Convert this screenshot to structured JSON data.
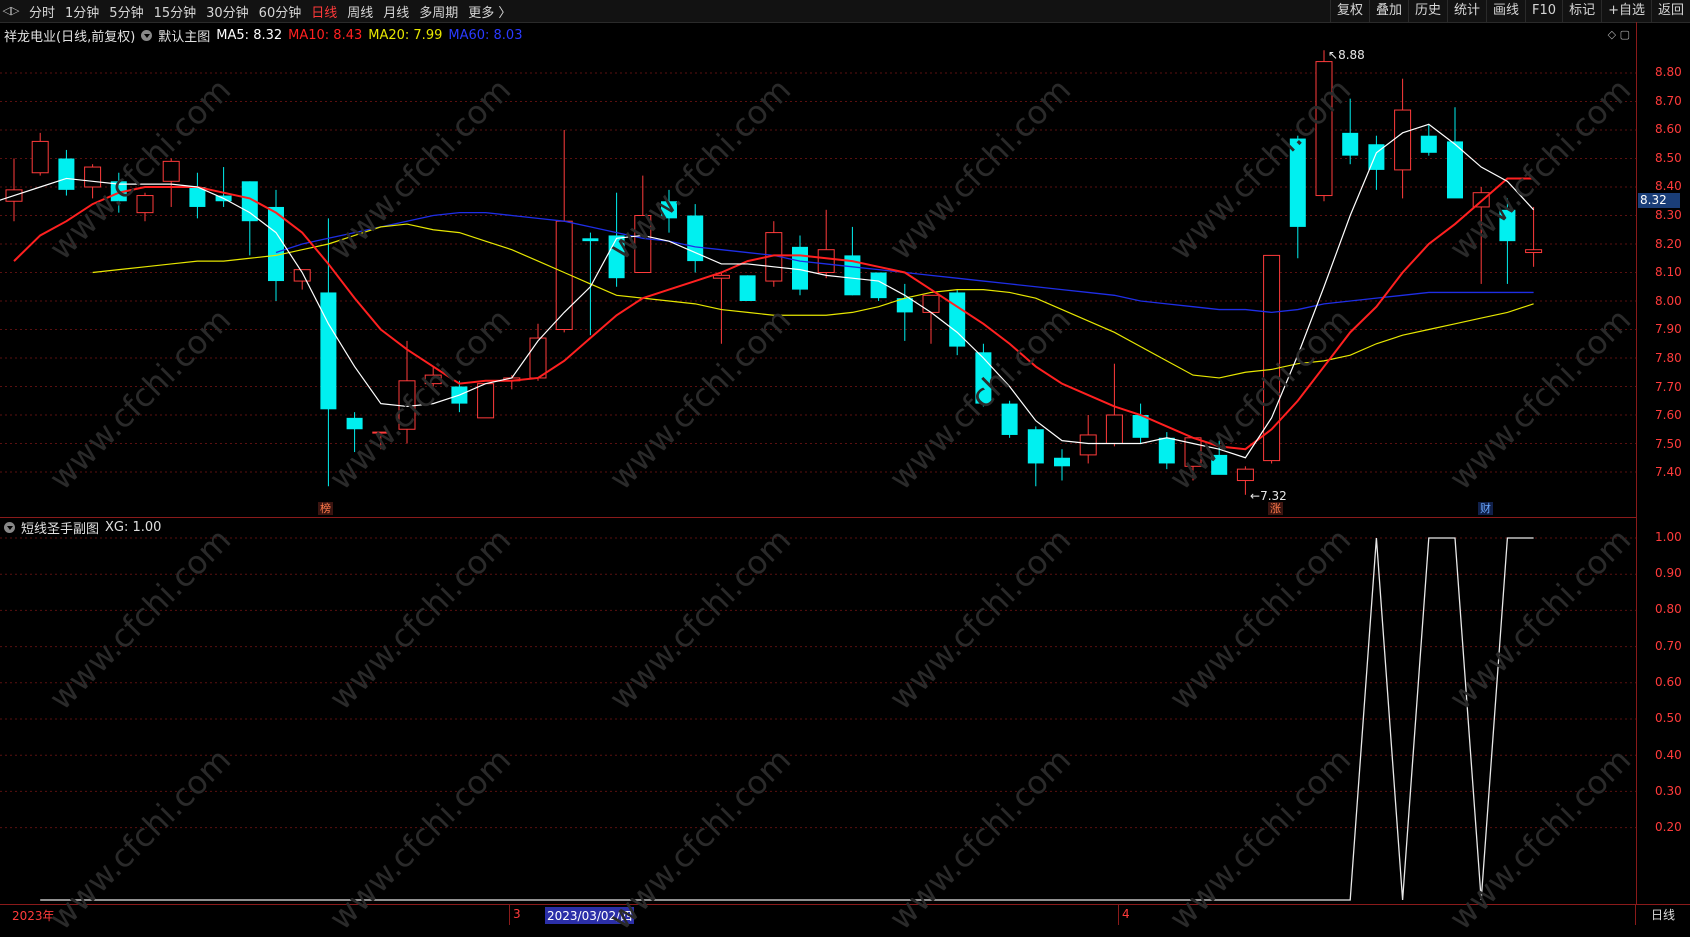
{
  "toolbar": {
    "periods": [
      "分时",
      "1分钟",
      "5分钟",
      "15分钟",
      "30分钟",
      "60分钟",
      "日线",
      "周线",
      "月线",
      "多周期",
      "更多 〉"
    ],
    "active_period": "日线",
    "right_buttons": [
      "复权",
      "叠加",
      "历史",
      "统计",
      "画线",
      "F10",
      "标记",
      "+自选",
      "返回"
    ]
  },
  "main_info": {
    "title": "祥龙电业(日线,前复权)",
    "chart_name": "默认主图",
    "ma5": "MA5: 8.32",
    "ma10": "MA10: 8.43",
    "ma20": "MA20: 7.99",
    "ma60": "MA60: 8.03"
  },
  "sub_info": {
    "title": "短线圣手副图",
    "xg": "XG: 1.00"
  },
  "price_axis": {
    "ticks": [
      "8.80",
      "8.70",
      "8.60",
      "8.50",
      "8.40",
      "8.30",
      "8.20",
      "8.10",
      "8.00",
      "7.90",
      "7.80",
      "7.70",
      "7.60",
      "7.50",
      "7.40"
    ],
    "current": "8.32"
  },
  "sub_axis": {
    "ticks": [
      "1.00",
      "0.90",
      "0.80",
      "0.70",
      "0.60",
      "0.50",
      "0.40",
      "0.30",
      "0.20"
    ]
  },
  "markers": {
    "high": "8.88",
    "low": "7.32",
    "m1": "榜",
    "m2": "涨",
    "m3": "财"
  },
  "dates": {
    "year": "2023年",
    "m3": "3",
    "selected": "2023/03/02/四",
    "m4": "4"
  },
  "period_label": "日线",
  "watermark": "www.cfchi.com",
  "colors": {
    "up": "#ff3b3b",
    "down": "#00f0f0",
    "ma5": "#ffffff",
    "ma10": "#ff2020",
    "ma20": "#e6e600",
    "ma60": "#1e2ee6",
    "grid": "#5a1010"
  },
  "chart_data": [
    {
      "type": "candlestick",
      "title": "祥龙电业(日线,前复权)",
      "ylim": [
        7.3,
        8.9
      ],
      "candles": [
        {
          "o": 8.35,
          "h": 8.5,
          "l": 8.28,
          "c": 8.39
        },
        {
          "o": 8.45,
          "h": 8.59,
          "l": 8.44,
          "c": 8.56
        },
        {
          "o": 8.5,
          "h": 8.53,
          "l": 8.37,
          "c": 8.39
        },
        {
          "o": 8.4,
          "h": 8.48,
          "l": 8.36,
          "c": 8.47
        },
        {
          "o": 8.42,
          "h": 8.45,
          "l": 8.31,
          "c": 8.35
        },
        {
          "o": 8.31,
          "h": 8.38,
          "l": 8.28,
          "c": 8.37
        },
        {
          "o": 8.42,
          "h": 8.5,
          "l": 8.33,
          "c": 8.49
        },
        {
          "o": 8.4,
          "h": 8.45,
          "l": 8.29,
          "c": 8.33
        },
        {
          "o": 8.37,
          "h": 8.47,
          "l": 8.33,
          "c": 8.35
        },
        {
          "o": 8.42,
          "h": 8.42,
          "l": 8.16,
          "c": 8.28
        },
        {
          "o": 8.33,
          "h": 8.39,
          "l": 8.0,
          "c": 8.07
        },
        {
          "o": 8.07,
          "h": 8.1,
          "l": 8.04,
          "c": 8.11
        },
        {
          "o": 8.03,
          "h": 8.29,
          "l": 7.35,
          "c": 7.62
        },
        {
          "o": 7.59,
          "h": 7.61,
          "l": 7.47,
          "c": 7.55
        },
        {
          "o": 7.54,
          "h": 7.54,
          "l": 7.48,
          "c": 7.54
        },
        {
          "o": 7.55,
          "h": 7.86,
          "l": 7.5,
          "c": 7.72
        },
        {
          "o": 7.71,
          "h": 7.77,
          "l": 7.7,
          "c": 7.74
        },
        {
          "o": 7.7,
          "h": 7.72,
          "l": 7.61,
          "c": 7.64
        },
        {
          "o": 7.59,
          "h": 7.71,
          "l": 7.59,
          "c": 7.71
        },
        {
          "o": 7.72,
          "h": 7.74,
          "l": 7.69,
          "c": 7.73
        },
        {
          "o": 7.73,
          "h": 7.92,
          "l": 7.72,
          "c": 7.87
        },
        {
          "o": 7.9,
          "h": 8.6,
          "l": 7.89,
          "c": 8.28
        },
        {
          "o": 8.22,
          "h": 8.24,
          "l": 7.88,
          "c": 8.21
        },
        {
          "o": 8.23,
          "h": 8.38,
          "l": 8.05,
          "c": 8.08
        },
        {
          "o": 8.1,
          "h": 8.44,
          "l": 8.1,
          "c": 8.3
        },
        {
          "o": 8.35,
          "h": 8.39,
          "l": 8.24,
          "c": 8.29
        },
        {
          "o": 8.3,
          "h": 8.34,
          "l": 8.1,
          "c": 8.14
        },
        {
          "o": 8.08,
          "h": 8.1,
          "l": 7.85,
          "c": 8.09
        },
        {
          "o": 8.09,
          "h": 8.09,
          "l": 8.0,
          "c": 8.0
        },
        {
          "o": 8.07,
          "h": 8.28,
          "l": 8.05,
          "c": 8.24
        },
        {
          "o": 8.19,
          "h": 8.23,
          "l": 8.02,
          "c": 8.04
        },
        {
          "o": 8.1,
          "h": 8.32,
          "l": 8.08,
          "c": 8.18
        },
        {
          "o": 8.16,
          "h": 8.26,
          "l": 8.02,
          "c": 8.02
        },
        {
          "o": 8.1,
          "h": 8.1,
          "l": 8.0,
          "c": 8.01
        },
        {
          "o": 8.01,
          "h": 8.06,
          "l": 7.86,
          "c": 7.96
        },
        {
          "o": 7.96,
          "h": 8.02,
          "l": 7.85,
          "c": 8.02
        },
        {
          "o": 8.03,
          "h": 8.04,
          "l": 7.81,
          "c": 7.84
        },
        {
          "o": 7.82,
          "h": 7.85,
          "l": 7.63,
          "c": 7.64
        },
        {
          "o": 7.64,
          "h": 7.65,
          "l": 7.52,
          "c": 7.53
        },
        {
          "o": 7.55,
          "h": 7.56,
          "l": 7.35,
          "c": 7.43
        },
        {
          "o": 7.45,
          "h": 7.48,
          "l": 7.37,
          "c": 7.42
        },
        {
          "o": 7.46,
          "h": 7.6,
          "l": 7.43,
          "c": 7.53
        },
        {
          "o": 7.5,
          "h": 7.78,
          "l": 7.49,
          "c": 7.6
        },
        {
          "o": 7.6,
          "h": 7.64,
          "l": 7.5,
          "c": 7.52
        },
        {
          "o": 7.52,
          "h": 7.54,
          "l": 7.41,
          "c": 7.43
        },
        {
          "o": 7.42,
          "h": 7.52,
          "l": 7.37,
          "c": 7.52
        },
        {
          "o": 7.46,
          "h": 7.51,
          "l": 7.4,
          "c": 7.39
        },
        {
          "o": 7.37,
          "h": 7.42,
          "l": 7.32,
          "c": 7.41
        },
        {
          "o": 7.44,
          "h": 8.16,
          "l": 7.43,
          "c": 8.16
        },
        {
          "o": 8.57,
          "h": 8.58,
          "l": 8.15,
          "c": 8.26
        },
        {
          "o": 8.37,
          "h": 8.88,
          "l": 8.35,
          "c": 8.84
        },
        {
          "o": 8.59,
          "h": 8.71,
          "l": 8.48,
          "c": 8.51
        },
        {
          "o": 8.55,
          "h": 8.58,
          "l": 8.39,
          "c": 8.46
        },
        {
          "o": 8.46,
          "h": 8.78,
          "l": 8.36,
          "c": 8.67
        },
        {
          "o": 8.58,
          "h": 8.62,
          "l": 8.51,
          "c": 8.52
        },
        {
          "o": 8.56,
          "h": 8.68,
          "l": 8.37,
          "c": 8.36
        },
        {
          "o": 8.33,
          "h": 8.4,
          "l": 8.06,
          "c": 8.38
        },
        {
          "o": 8.32,
          "h": 8.36,
          "l": 8.06,
          "c": 8.21
        },
        {
          "o": 8.17,
          "h": 8.33,
          "l": 8.12,
          "c": 8.18
        }
      ],
      "ma5": [
        8.34,
        8.37,
        8.4,
        8.43,
        8.42,
        8.41,
        8.41,
        8.41,
        8.4,
        8.36,
        8.31,
        8.24,
        8.1,
        7.92,
        7.77,
        7.64,
        7.63,
        7.64,
        7.67,
        7.71,
        7.73,
        7.86,
        7.96,
        8.05,
        8.22,
        8.23,
        8.21,
        8.17,
        8.13,
        8.13,
        8.12,
        8.11,
        8.09,
        8.08,
        8.07,
        8.02,
        7.96,
        7.89,
        7.8,
        7.7,
        7.58,
        7.51,
        7.5,
        7.5,
        7.5,
        7.52,
        7.5,
        7.48,
        7.45,
        7.59,
        7.81,
        8.05,
        8.3,
        8.52,
        8.59,
        8.62,
        8.55,
        8.47,
        8.42,
        8.32
      ],
      "ma10": [
        8.14,
        8.23,
        8.28,
        8.34,
        8.38,
        8.4,
        8.4,
        8.4,
        8.38,
        8.36,
        8.31,
        8.24,
        8.13,
        8.01,
        7.9,
        7.83,
        7.77,
        7.71,
        7.72,
        7.72,
        7.73,
        7.79,
        7.87,
        7.95,
        8.01,
        8.04,
        8.07,
        8.1,
        8.14,
        8.16,
        8.16,
        8.15,
        8.14,
        8.12,
        8.1,
        8.04,
        7.98,
        7.92,
        7.85,
        7.77,
        7.71,
        7.67,
        7.63,
        7.6,
        7.56,
        7.52,
        7.49,
        7.48,
        7.55,
        7.65,
        7.77,
        7.89,
        7.98,
        8.1,
        8.2,
        8.27,
        8.35,
        8.43,
        8.43
      ],
      "ma20": [
        8.1,
        8.11,
        8.12,
        8.13,
        8.14,
        8.14,
        8.15,
        8.16,
        8.18,
        8.2,
        8.23,
        8.26,
        8.27,
        8.25,
        8.24,
        8.21,
        8.18,
        8.14,
        8.1,
        8.06,
        8.02,
        8.01,
        8.0,
        7.99,
        7.97,
        7.96,
        7.95,
        7.95,
        7.95,
        7.96,
        7.98,
        8.01,
        8.03,
        8.04,
        8.04,
        8.03,
        8.01,
        7.97,
        7.93,
        7.89,
        7.84,
        7.79,
        7.74,
        7.73,
        7.75,
        7.76,
        7.78,
        7.79,
        7.81,
        7.85,
        7.88,
        7.9,
        7.92,
        7.94,
        7.96,
        7.99
      ],
      "ma60": [
        8.17,
        8.2,
        8.22,
        8.24,
        8.26,
        8.28,
        8.3,
        8.31,
        8.31,
        8.3,
        8.29,
        8.28,
        8.26,
        8.24,
        8.22,
        8.21,
        8.19,
        8.18,
        8.17,
        8.16,
        8.14,
        8.13,
        8.12,
        8.11,
        8.1,
        8.09,
        8.08,
        8.07,
        8.06,
        8.05,
        8.04,
        8.03,
        8.02,
        8.0,
        7.99,
        7.98,
        7.97,
        7.97,
        7.96,
        7.97,
        7.99,
        8.0,
        8.01,
        8.02,
        8.03,
        8.03,
        8.03,
        8.03,
        8.03
      ]
    },
    {
      "type": "line",
      "title": "短线圣手副图",
      "ylim": [
        0,
        1
      ],
      "series": [
        {
          "name": "XG",
          "values": [
            0,
            0,
            0,
            0,
            0,
            0,
            0,
            0,
            0,
            0,
            0,
            0,
            0,
            0,
            0,
            0,
            0,
            0,
            0,
            0,
            0,
            0,
            0,
            0,
            0,
            0,
            0,
            0,
            0,
            0,
            0,
            0,
            0,
            0,
            0,
            0,
            0,
            0,
            0,
            0,
            0,
            0,
            0,
            0,
            0,
            0,
            0,
            0,
            0,
            0,
            0,
            1,
            0,
            1,
            1,
            0,
            1,
            1
          ]
        }
      ]
    }
  ]
}
